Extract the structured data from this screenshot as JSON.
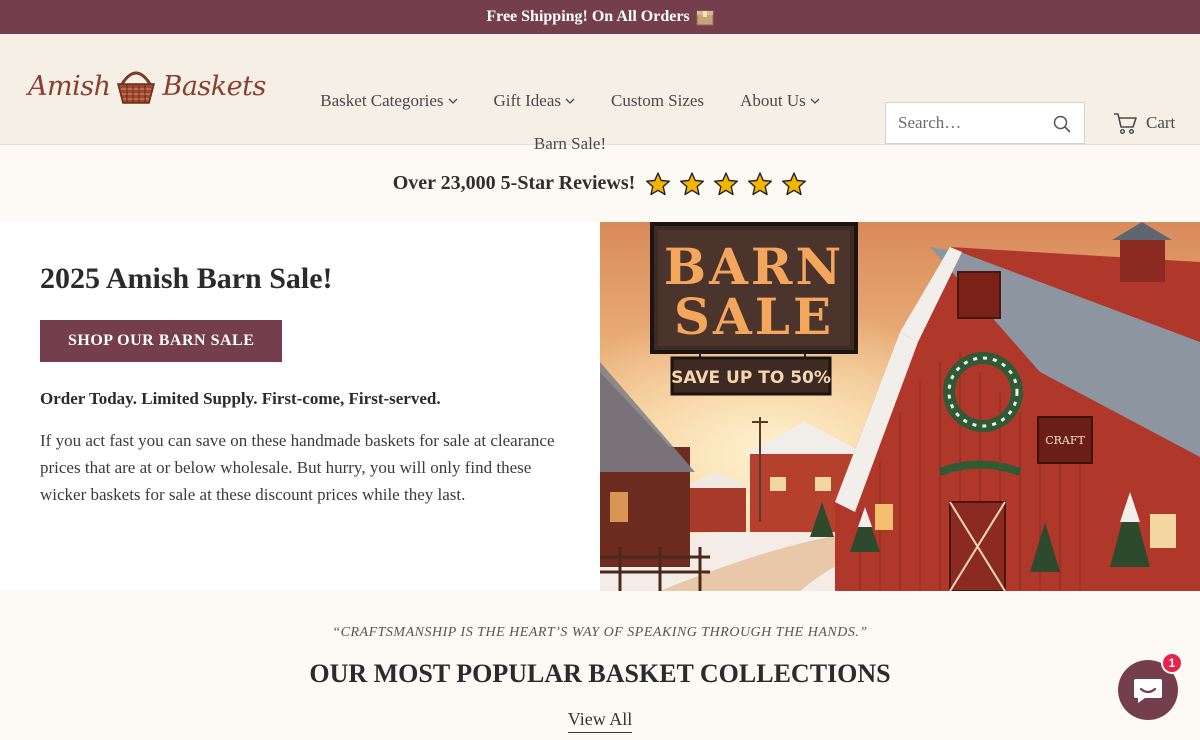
{
  "announcement": {
    "text": "Free Shipping! On All Orders",
    "icon": "box-icon"
  },
  "logo": {
    "word1": "Amish",
    "word2": "Baskets"
  },
  "nav": {
    "row1": [
      {
        "label": "Basket Categories",
        "dropdown": true
      },
      {
        "label": "Gift Ideas",
        "dropdown": true
      },
      {
        "label": "Custom Sizes",
        "dropdown": false
      },
      {
        "label": "About Us",
        "dropdown": true
      }
    ],
    "row2": [
      {
        "label": "Barn Sale!",
        "dropdown": false
      }
    ]
  },
  "search": {
    "placeholder": "Search…"
  },
  "cart": {
    "label": "Cart"
  },
  "reviews": {
    "text": "Over 23,000 5-Star Reviews!",
    "stars": 5
  },
  "hero": {
    "title": "2025 Amish Barn Sale!",
    "cta": "SHOP OUR BARN SALE",
    "subhead": "Order Today. Limited Supply. First-come, First-served.",
    "body": "If you act fast you can save on these handmade baskets for sale at clearance prices that are at or below wholesale. But hurry, you will only find these wicker baskets for sale at these discount prices while they last.",
    "image": {
      "sign_line1": "BARN",
      "sign_line2": "SALE",
      "banner": "SAVE UP TO 50%",
      "barn_sign": "CRAFT"
    }
  },
  "collections": {
    "quote": "“CRAFTSMANSHIP IS THE HEART’S WAY OF SPEAKING THROUGH THE HANDS.”",
    "title": "OUR MOST POPULAR BASKET COLLECTIONS",
    "view_all": "View All"
  },
  "chat": {
    "badge": "1"
  },
  "colors": {
    "brand": "#743e4d",
    "header_bg": "#f5efe6",
    "star": "#f5b400",
    "badge": "#e5234b"
  }
}
